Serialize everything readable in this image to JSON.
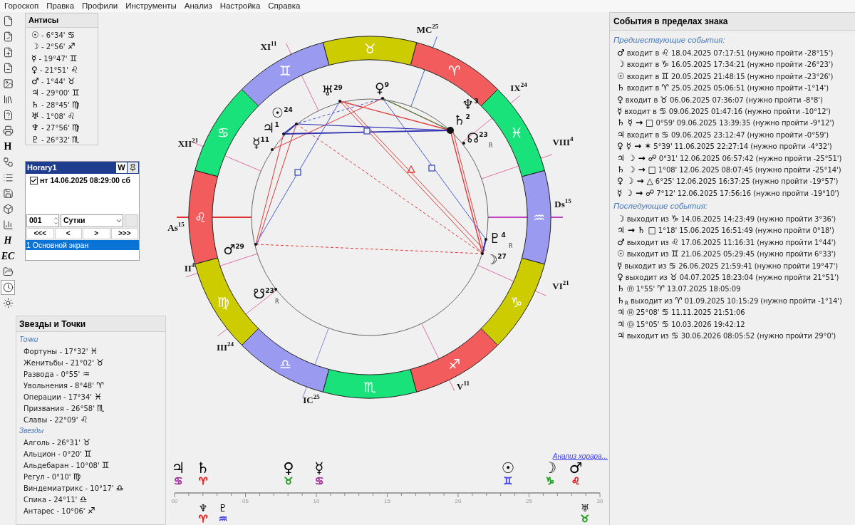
{
  "menu": [
    "Гороскоп",
    "Правка",
    "Профили",
    "Инструменты",
    "Анализ",
    "Настройка",
    "Справка"
  ],
  "toolbar": [
    {
      "kind": "icon",
      "pressed": false
    },
    {
      "kind": "icon",
      "pressed": false
    },
    {
      "kind": "icon",
      "pressed": false
    },
    {
      "kind": "icon",
      "pressed": false
    },
    {
      "kind": "icon",
      "pressed": false
    },
    {
      "kind": "icon",
      "pressed": false
    },
    {
      "kind": "icon",
      "pressed": false
    },
    {
      "kind": "icon",
      "pressed": false
    },
    {
      "kind": "text",
      "label": "H",
      "pressed": false
    },
    {
      "kind": "icon",
      "pressed": false
    },
    {
      "kind": "icon",
      "pressed": false
    },
    {
      "kind": "icon",
      "pressed": false
    },
    {
      "kind": "icon",
      "pressed": false
    },
    {
      "kind": "icon",
      "pressed": false
    },
    {
      "kind": "script",
      "label": "H",
      "pressed": false
    },
    {
      "kind": "script",
      "label": "EC",
      "pressed": false
    },
    {
      "kind": "icon",
      "pressed": false
    },
    {
      "kind": "icon",
      "pressed": true
    },
    {
      "kind": "icon",
      "pressed": false
    }
  ],
  "antiscia": {
    "title": "Антисы",
    "items": [
      "**☉** - 6°34' **♋**",
      "**☽** - 2°56' **♐**",
      "**☿** - 19°47' **♊**",
      "**♀** - 21°51' **♌**",
      "**♂** - 1°44' **♉**",
      "**♃** - 29°00' **♊**",
      "**♄** - 28°45' **♍**",
      "**♅** - 1°08' **♌**",
      "**♆** - 27°56' **♍**",
      "**♇** - 26°32' **♏**"
    ]
  },
  "horary": {
    "title": "Horary1",
    "w_button": "W",
    "entries": [
      {
        "text": "нт 14.06.2025 08:29:00 сб",
        "checked": true
      }
    ],
    "count": "001",
    "period": "Сутки",
    "nav": [
      "<<<",
      "<",
      ">",
      ">>>"
    ],
    "screens": [
      {
        "label": "1 Основной экран",
        "selected": true
      }
    ]
  },
  "stars_panel": {
    "title": "Звезды и Точки",
    "sections": [
      {
        "heading": "Точки",
        "items": [
          "Фортуны - 17°32' **♓**",
          "Женитьбы - 21°02' **♉**",
          "Развода - 0°55' **♒**",
          "Увольнения - 8°48' **♈**",
          "Операции - 17°34' **♓**",
          "Призвания - 26°58' **♏**",
          "Славы - 22°09' **♌**"
        ]
      },
      {
        "heading": "Звезды",
        "items": [
          "Алголь - 26°31' **♉**",
          "Альцион - 0°20' **♊**",
          "Альдебаран - 10°08' **♊**",
          "Регул - 0°10' **♍**",
          "Виндемиатрикс - 10°17' **♎**",
          "Спика - 24°11' **♎**",
          "Антарес - 10°06' **♐**"
        ]
      }
    ]
  },
  "chart": {
    "signs": [
      {
        "glyph": "♈",
        "color": "#f25c5c"
      },
      {
        "glyph": "♉",
        "color": "#cccc00"
      },
      {
        "glyph": "♊",
        "color": "#9a9af0"
      },
      {
        "glyph": "♋",
        "color": "#19e27a"
      },
      {
        "glyph": "♌",
        "color": "#f25c5c"
      },
      {
        "glyph": "♍",
        "color": "#cccc00"
      },
      {
        "glyph": "♎",
        "color": "#9a9af0"
      },
      {
        "glyph": "♏",
        "color": "#19e27a"
      },
      {
        "glyph": "♐",
        "color": "#f25c5c"
      },
      {
        "glyph": "♑",
        "color": "#cccc00"
      },
      {
        "glyph": "♒",
        "color": "#9a9af0"
      },
      {
        "glyph": "♓",
        "color": "#19e27a"
      }
    ],
    "houses": [
      {
        "label": "MC",
        "degree": "25"
      },
      {
        "label": "IX",
        "degree": "24"
      },
      {
        "label": "VIII",
        "degree": "4"
      },
      {
        "label": "Ds",
        "degree": "15"
      },
      {
        "label": "VI",
        "degree": "21"
      },
      {
        "label": "V",
        "degree": "11"
      },
      {
        "label": "IC",
        "degree": "25"
      },
      {
        "label": "III",
        "degree": "24"
      },
      {
        "label": "II",
        "degree": "4"
      },
      {
        "label": "As",
        "degree": "15"
      },
      {
        "label": "XII",
        "degree": "21"
      },
      {
        "label": "XI",
        "degree": "11"
      }
    ],
    "planets": [
      {
        "glyph": "♅",
        "degree": "29"
      },
      {
        "glyph": "♀",
        "degree": "9"
      },
      {
        "glyph": "☉",
        "degree": "24"
      },
      {
        "glyph": "♃",
        "degree": "1"
      },
      {
        "glyph": "☿",
        "degree": "11"
      },
      {
        "glyph": "♄",
        "degree": "2"
      },
      {
        "glyph": "♆",
        "degree": "3"
      },
      {
        "glyph": "☊",
        "degree": "23",
        "retro": "R"
      },
      {
        "glyph": "♇",
        "degree": "4",
        "retro": "R"
      },
      {
        "glyph": "☽",
        "degree": "27"
      },
      {
        "glyph": "♂",
        "degree": "29"
      },
      {
        "glyph": "☋",
        "degree": "23",
        "retro": "R"
      }
    ]
  },
  "timeline": {
    "link": "Анализ хорара...",
    "ticks": [
      "00",
      "05",
      "10",
      "15",
      "20",
      "25",
      "30"
    ],
    "above": [
      {
        "planet": "♃",
        "sign": "♋",
        "color": "#a0309a"
      },
      {
        "planet": "♄",
        "sign": "♈",
        "color": "#e82020"
      },
      {
        "planet": "♀",
        "sign": "♉",
        "color": "#20a020"
      },
      {
        "planet": "☿",
        "sign": "♋",
        "color": "#a0309a"
      },
      {
        "planet": "☉",
        "sign": "♊",
        "color": "#4848e8"
      },
      {
        "planet": "☽",
        "sign": "♑",
        "color": "#20a020"
      },
      {
        "planet": "♂",
        "sign": "♌",
        "color": "#e82020"
      }
    ],
    "below": [
      {
        "planet": "♆",
        "sign": "♈",
        "color": "#e82020"
      },
      {
        "planet": "♇",
        "sign": "♒",
        "color": "#4848e8"
      },
      {
        "planet": "♅",
        "sign": "♉",
        "color": "#20a020"
      }
    ]
  },
  "events": {
    "title": "События в пределах знака",
    "sections": [
      {
        "heading": "Предшествующие события:",
        "items": [
          "**♂** входит в **♌** 18.04.2025 07:17:51 (нужно пройти -28°15')",
          "**☽** входит в **♑** 16.05.2025 17:34:21 (нужно пройти -26°23')",
          "**☉** входит в **♊** 20.05.2025 21:48:15 (нужно пройти -23°26')",
          "**♄** входит в **♈** 25.05.2025 05:06:51 (нужно пройти -1°14')",
          "**♀** входит в **♉** 06.06.2025 07:36:07 (нужно пройти -8°8')",
          "**☿** входит в **♋** 09.06.2025 01:47:16 (нужно пройти -10°12')",
          "**♄ ☿ → □** 0°59' 09.06.2025 13:39:35 (нужно пройти -9°12')",
          "**♃** входит в **♋** 09.06.2025 23:12:47 (нужно пройти -0°59')",
          "**♀ ☿ → ✶** 5°39' 11.06.2025 22:27:14 (нужно пройти -4°32')",
          "**♃ ☽ → ☍** 0°31' 12.06.2025 06:57:42 (нужно пройти -25°51')",
          "**♄ ☽ → □** 1°08' 12.06.2025 08:07:45 (нужно пройти -25°14')",
          "**♀ ☽ → △** 6°25' 12.06.2025 16:37:25 (нужно пройти -19°57')",
          "**☿ ☽ → ☍** 7°12' 12.06.2025 17:56:16 (нужно пройти -19°10')"
        ]
      },
      {
        "heading": "Последующие события:",
        "items": [
          "**☽** выходит из **♑** 14.06.2025 14:23:49 (нужно пройти 3°36')",
          "**♃ → ♄ □** 1°18' 15.06.2025 16:51:49 (нужно пройти 0°18')",
          "**♂** выходит из **♌** 17.06.2025 11:16:31 (нужно пройти 1°44')",
          "**☉** выходит из **♊** 21.06.2025 05:29:45 (нужно пройти 6°33')",
          "**☿** выходит из **♋** 26.06.2025 21:59:41 (нужно пройти 19°47')",
          "**♀** выходит из **♉** 04.07.2025 18:23:04 (нужно пройти 21°51')",
          "**♄** Ⓡ 1°55' **♈** 13.07.2025 18:05:09",
          "**♄**$_{R}$ выходит из **♈** 01.09.2025 10:15:29 (нужно пройти -1°14')",
          "**♃** Ⓡ 25°08' **♋** 11.11.2025 21:51:06",
          "**♃** Ⓓ 15°05' **♋** 10.03.2026 19:42:12",
          "**♃** выходит из **♋** 30.06.2026 08:05:52 (нужно пройти 29°0')"
        ]
      }
    ]
  }
}
